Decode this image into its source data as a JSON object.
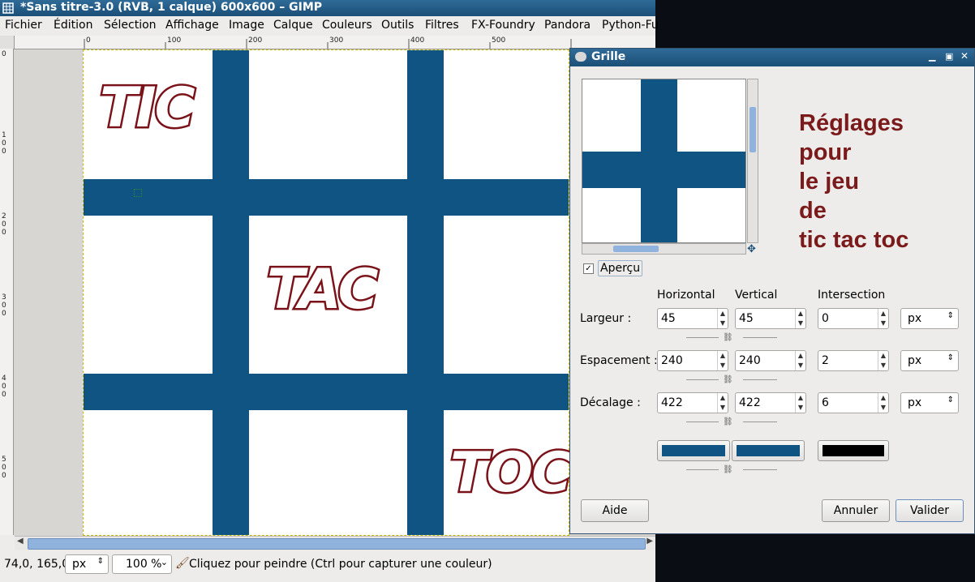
{
  "window": {
    "title": "*Sans titre-3.0 (RVB, 1 calque) 600x600 – GIMP"
  },
  "menu": [
    "Fichier",
    "Édition",
    "Sélection",
    "Affichage",
    "Image",
    "Calque",
    "Couleurs",
    "Outils",
    "Filtres",
    "FX-Foundry",
    "Pandora",
    "Python-Fu"
  ],
  "hruler": {
    "labels": [
      "0",
      "100",
      "200",
      "300",
      "400",
      "500"
    ]
  },
  "vruler": {
    "labels": [
      "0",
      "100",
      "200",
      "300",
      "400",
      "500"
    ]
  },
  "canvas": {
    "words": [
      "TIC",
      "TAC",
      "TOC"
    ],
    "grid_color": "#0f5482",
    "word_outline_color": "#7a1219"
  },
  "status": {
    "coords": "74,0, 165,0",
    "unit": "px",
    "zoom": "100 %",
    "message": "Cliquez pour peindre (Ctrl pour capturer une couleur)"
  },
  "dialog": {
    "title": "Grille",
    "heading": [
      "Réglages",
      "pour",
      "le jeu",
      "de",
      "tic tac toc"
    ],
    "preview_checkbox": {
      "label": "Aperçu",
      "checked": true
    },
    "columns": {
      "horizontal": "Horizontal",
      "vertical": "Vertical",
      "intersection": "Intersection"
    },
    "rows": [
      {
        "label": "Largeur :",
        "horizontal": "45",
        "vertical": "45",
        "intersection": "0",
        "unit": "px"
      },
      {
        "label": "Espacement :",
        "horizontal": "240",
        "vertical": "240",
        "intersection": "2",
        "unit": "px"
      },
      {
        "label": "Décalage :",
        "horizontal": "422",
        "vertical": "422",
        "intersection": "6",
        "unit": "px"
      }
    ],
    "colors": {
      "horizontal": "#0f5482",
      "vertical": "#0f5482",
      "intersection": "#000000"
    },
    "buttons": {
      "help": "Aide",
      "cancel": "Annuler",
      "ok": "Valider"
    }
  }
}
